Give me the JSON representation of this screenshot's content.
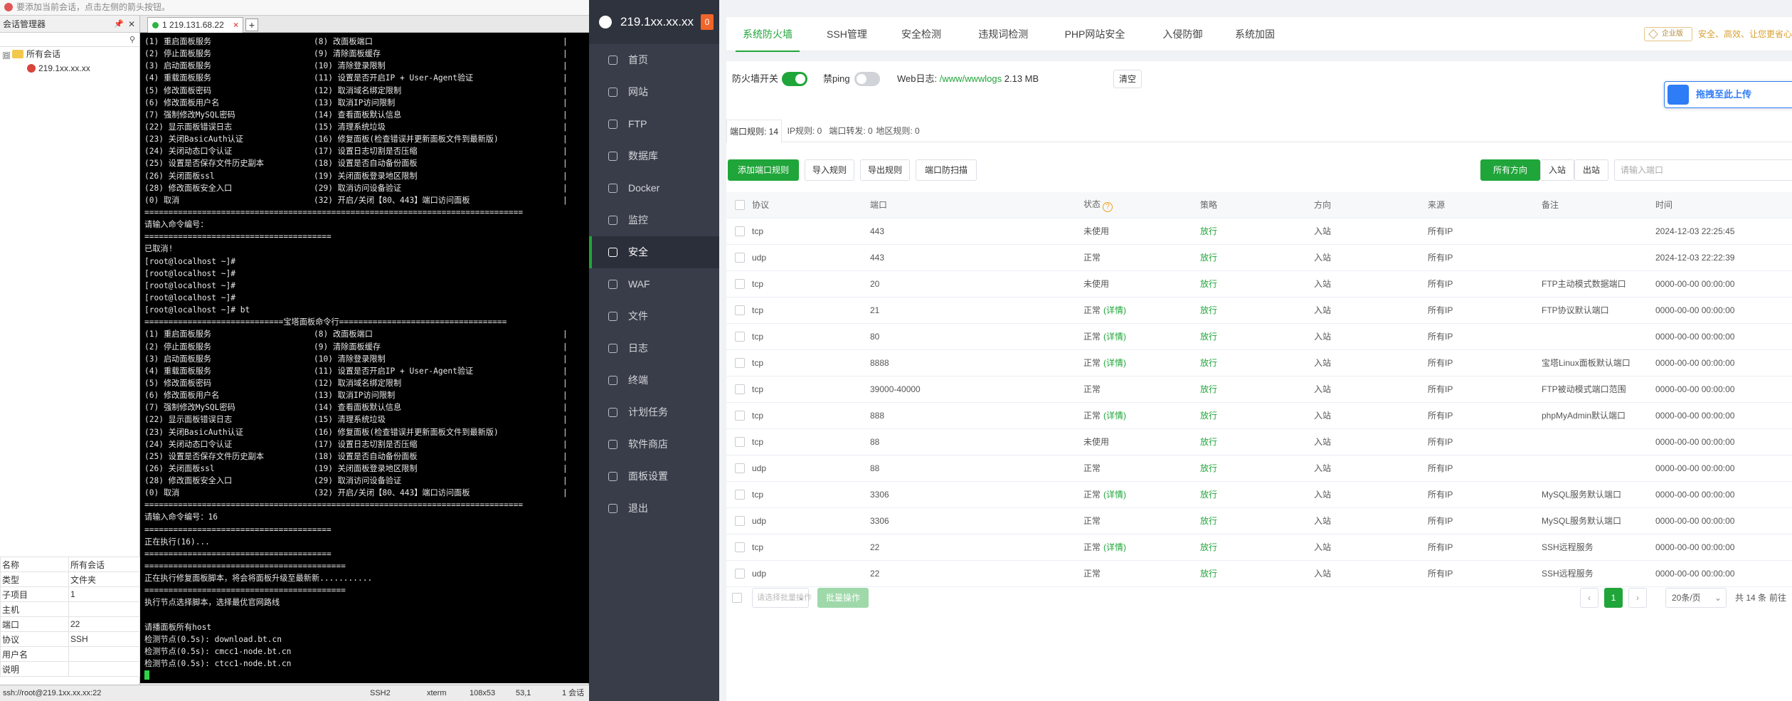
{
  "client": {
    "topbar_hint": "要添加当前会话，点击左侧的箭头按钮。",
    "session_panel": {
      "title": "会话管理器",
      "pin": "📌",
      "close": "✕",
      "tree": [
        {
          "label": "所有会话",
          "toggle": "⊟"
        },
        {
          "label": "219.1xx.xx.xx"
        }
      ]
    },
    "properties": [
      [
        "名称",
        "所有会话"
      ],
      [
        "类型",
        "文件夹"
      ],
      [
        "子项目",
        "1"
      ],
      [
        "主机",
        ""
      ],
      [
        "端口",
        "22"
      ],
      [
        "协议",
        "SSH"
      ],
      [
        "用户名",
        ""
      ],
      [
        "说明",
        ""
      ]
    ],
    "tab": {
      "label": "1 219.131.68.22",
      "close": "×",
      "new": "+"
    },
    "statusbar": {
      "address": "ssh://root@219.1xx.xx.xx:22",
      "protocol": "SSH2",
      "term": "xterm",
      "size": "108x53",
      "pos": "53,1",
      "sessions": "1 会话"
    }
  },
  "terminal": {
    "lines": [
      [
        "(1) 重启面板服务",
        "(8) 改面板端口",
        "|"
      ],
      [
        "(2) 停止面板服务",
        "(9) 清除面板缓存",
        "|"
      ],
      [
        "(3) 启动面板服务",
        "(10) 清除登录限制",
        "|"
      ],
      [
        "(4) 重载面板服务",
        "(11) 设置是否开启IP + User-Agent验证",
        "|"
      ],
      [
        "(5) 修改面板密码",
        "(12) 取消域名绑定限制",
        "|"
      ],
      [
        "(6) 修改面板用户名",
        "(13) 取消IP访问限制",
        "|"
      ],
      [
        "(7) 强制修改MySQL密码",
        "(14) 查看面板默认信息",
        "|"
      ],
      [
        "(22) 显示面板错误日志",
        "(15) 清理系统垃圾",
        "|"
      ],
      [
        "(23) 关闭BasicAuth认证",
        "(16) 修复面板(检查错误并更新面板文件到最新版)",
        "|"
      ],
      [
        "(24) 关闭动态口令认证",
        "(17) 设置日志切割是否压缩",
        "|"
      ],
      [
        "(25) 设置是否保存文件历史副本",
        "(18) 设置是否自动备份面板",
        "|"
      ],
      [
        "(26) 关闭面板ssl",
        "(19) 关闭面板登录地区限制",
        "|"
      ],
      [
        "(28) 修改面板安全入口",
        "(29) 取消访问设备验证",
        "|"
      ],
      [
        "(0) 取消",
        "(32) 开启/关闭【80、443】端口访问面板",
        "|"
      ],
      [
        "===============================================================================",
        "",
        ""
      ],
      [
        "请输入命令编号：",
        "",
        ""
      ],
      [
        "=======================================",
        "",
        ""
      ],
      [
        "已取消!",
        "",
        ""
      ],
      [
        "[root@localhost ~]#",
        "",
        ""
      ],
      [
        "[root@localhost ~]#",
        "",
        ""
      ],
      [
        "[root@localhost ~]#",
        "",
        ""
      ],
      [
        "[root@localhost ~]#",
        "",
        ""
      ],
      [
        "[root@localhost ~]# bt",
        "",
        ""
      ],
      [
        "=============================宝塔面板命令行===================================",
        "",
        ""
      ],
      [
        "(1) 重启面板服务",
        "(8) 改面板端口",
        "|"
      ],
      [
        "(2) 停止面板服务",
        "(9) 清除面板缓存",
        "|"
      ],
      [
        "(3) 启动面板服务",
        "(10) 清除登录限制",
        "|"
      ],
      [
        "(4) 重载面板服务",
        "(11) 设置是否开启IP + User-Agent验证",
        "|"
      ],
      [
        "(5) 修改面板密码",
        "(12) 取消域名绑定限制",
        "|"
      ],
      [
        "(6) 修改面板用户名",
        "(13) 取消IP访问限制",
        "|"
      ],
      [
        "(7) 强制修改MySQL密码",
        "(14) 查看面板默认信息",
        "|"
      ],
      [
        "(22) 显示面板错误日志",
        "(15) 清理系统垃圾",
        "|"
      ],
      [
        "(23) 关闭BasicAuth认证",
        "(16) 修复面板(检查错误并更新面板文件到最新版)",
        "|"
      ],
      [
        "(24) 关闭动态口令认证",
        "(17) 设置日志切割是否压缩",
        "|"
      ],
      [
        "(25) 设置是否保存文件历史副本",
        "(18) 设置是否自动备份面板",
        "|"
      ],
      [
        "(26) 关闭面板ssl",
        "(19) 关闭面板登录地区限制",
        "|"
      ],
      [
        "(28) 修改面板安全入口",
        "(29) 取消访问设备验证",
        "|"
      ],
      [
        "(0) 取消",
        "(32) 开启/关闭【80、443】端口访问面板",
        "|"
      ],
      [
        "===============================================================================",
        "",
        ""
      ],
      [
        "请输入命令编号：16",
        "",
        ""
      ],
      [
        "=======================================",
        "",
        ""
      ],
      [
        "正在执行(16)...",
        "",
        ""
      ],
      [
        "=======================================",
        "",
        ""
      ],
      [
        "==========================================",
        "",
        ""
      ],
      [
        "正在执行修复面板脚本，将会将面板升级至最新新...........",
        "",
        ""
      ],
      [
        "==========================================",
        "",
        ""
      ],
      [
        "执行节点选择脚本，选择最优官网路线",
        "",
        ""
      ],
      [
        "",
        "",
        ""
      ],
      [
        "请播面板所有host",
        "",
        ""
      ],
      [
        "检测节点(0.5s): download.bt.cn",
        "",
        ""
      ],
      [
        "检测节点(0.5s): cmcc1-node.bt.cn",
        "",
        ""
      ],
      [
        "检测节点(0.5s): ctcc1-node.bt.cn",
        "",
        ""
      ]
    ]
  },
  "sidebar": {
    "server": "219.1xx.xx.xx",
    "badge": "0",
    "items": [
      {
        "label": "首页",
        "icon": "home-icon"
      },
      {
        "label": "网站",
        "icon": "globe-icon"
      },
      {
        "label": "FTP",
        "icon": "ftp-icon"
      },
      {
        "label": "数据库",
        "icon": "database-icon"
      },
      {
        "label": "Docker",
        "icon": "docker-icon"
      },
      {
        "label": "监控",
        "icon": "monitor-icon"
      },
      {
        "label": "安全",
        "icon": "shield-icon",
        "active": true
      },
      {
        "label": "WAF",
        "icon": "waf-icon"
      },
      {
        "label": "文件",
        "icon": "folder-icon"
      },
      {
        "label": "日志",
        "icon": "log-icon"
      },
      {
        "label": "终端",
        "icon": "terminal-icon"
      },
      {
        "label": "计划任务",
        "icon": "clock-icon"
      },
      {
        "label": "软件商店",
        "icon": "store-icon"
      },
      {
        "label": "面板设置",
        "icon": "gear-icon"
      },
      {
        "label": "退出",
        "icon": "logout-icon"
      }
    ]
  },
  "top_tabs": [
    "系统防火墙",
    "SSH管理",
    "安全检测",
    "违规词检测",
    "PHP网站安全",
    "入侵防御",
    "系统加固"
  ],
  "enterprise": {
    "badge": "企业版",
    "note": "安全、高效、让您更省心"
  },
  "firewall": {
    "switch_label": "防火墙开关",
    "ping_label": "禁ping",
    "weblog_label": "Web日志:",
    "weblog_path": "/www/wwwlogs",
    "weblog_size": "2.13 MB",
    "clear_label": "清空",
    "upload_tip": "拖拽至此上传"
  },
  "sub_tabs": [
    "端口规则: 14",
    "IP规则: 0",
    "端口转发: 0",
    "地区规则: 0"
  ],
  "toolbar": {
    "add": "添加端口规则",
    "import": "导入规则",
    "export": "导出规则",
    "scan": "端口防扫描",
    "dir_all": "所有方向",
    "dir_in": "入站",
    "dir_out": "出站",
    "search_placeholder": "请输入端口"
  },
  "table": {
    "headers": [
      "协议",
      "端口",
      "状态",
      "策略",
      "方向",
      "来源",
      "备注",
      "时间"
    ],
    "detail_label": "(详情)",
    "rows": [
      [
        "tcp",
        "443",
        "未使用",
        false,
        "放行",
        "入站",
        "所有IP",
        "",
        "2024-12-03 22:25:45"
      ],
      [
        "udp",
        "443",
        "正常",
        false,
        "放行",
        "入站",
        "所有IP",
        "",
        "2024-12-03 22:22:39"
      ],
      [
        "tcp",
        "20",
        "未使用",
        false,
        "放行",
        "入站",
        "所有IP",
        "FTP主动模式数据端口",
        "0000-00-00 00:00:00"
      ],
      [
        "tcp",
        "21",
        "正常",
        true,
        "放行",
        "入站",
        "所有IP",
        "FTP协议默认端口",
        "0000-00-00 00:00:00"
      ],
      [
        "tcp",
        "80",
        "正常",
        true,
        "放行",
        "入站",
        "所有IP",
        "",
        "0000-00-00 00:00:00"
      ],
      [
        "tcp",
        "8888",
        "正常",
        true,
        "放行",
        "入站",
        "所有IP",
        "宝塔Linux面板默认端口",
        "0000-00-00 00:00:00"
      ],
      [
        "tcp",
        "39000-40000",
        "正常",
        false,
        "放行",
        "入站",
        "所有IP",
        "FTP被动模式端口范围",
        "0000-00-00 00:00:00"
      ],
      [
        "tcp",
        "888",
        "正常",
        true,
        "放行",
        "入站",
        "所有IP",
        "phpMyAdmin默认端口",
        "0000-00-00 00:00:00"
      ],
      [
        "tcp",
        "88",
        "未使用",
        false,
        "放行",
        "入站",
        "所有IP",
        "",
        "0000-00-00 00:00:00"
      ],
      [
        "udp",
        "88",
        "正常",
        false,
        "放行",
        "入站",
        "所有IP",
        "",
        "0000-00-00 00:00:00"
      ],
      [
        "tcp",
        "3306",
        "正常",
        true,
        "放行",
        "入站",
        "所有IP",
        "MySQL服务默认端口",
        "0000-00-00 00:00:00"
      ],
      [
        "udp",
        "3306",
        "正常",
        false,
        "放行",
        "入站",
        "所有IP",
        "MySQL服务默认端口",
        "0000-00-00 00:00:00"
      ],
      [
        "tcp",
        "22",
        "正常",
        true,
        "放行",
        "入站",
        "所有IP",
        "SSH远程服务",
        "0000-00-00 00:00:00"
      ],
      [
        "udp",
        "22",
        "正常",
        false,
        "放行",
        "入站",
        "所有IP",
        "SSH远程服务",
        "0000-00-00 00:00:00"
      ]
    ]
  },
  "pager": {
    "batch_placeholder": "请选择批量操作",
    "batch_button": "批量操作",
    "prev": "‹",
    "current": "1",
    "next": "›",
    "page_size": "20条/页",
    "total": "共 14 条",
    "first": "前往"
  }
}
